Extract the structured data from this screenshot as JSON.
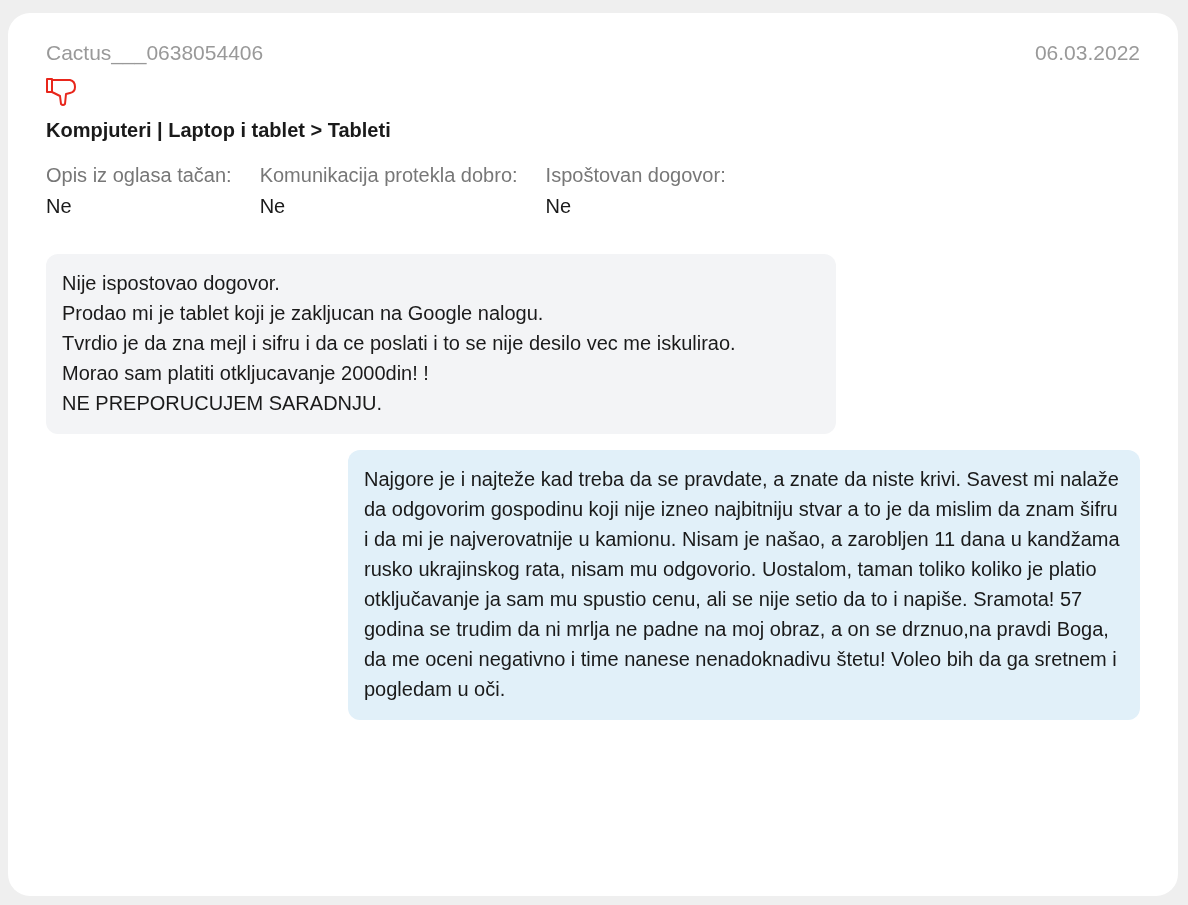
{
  "review": {
    "author": "Cactus___0638054406",
    "date": "06.03.2022",
    "negative": true,
    "category": "Kompjuteri | Laptop i tablet > Tableti",
    "criteria": [
      {
        "label": "Opis iz oglasa tačan:",
        "value": "Ne"
      },
      {
        "label": "Komunikacija protekla dobro:",
        "value": "Ne"
      },
      {
        "label": "Ispoštovan dogovor:",
        "value": "Ne"
      }
    ],
    "messages": [
      {
        "kind": "review",
        "lines": [
          "Nije ispostovao dogovor.",
          "Prodao mi je tablet koji je zakljucan na Google nalogu.",
          "Tvrdio je da zna mejl i sifru i da ce poslati i to se nije desilo vec me iskulirao.",
          "Morao sam platiti otkljucavanje 2000din! !",
          "NE PREPORUCUJEM SARADNJU."
        ]
      },
      {
        "kind": "reply",
        "lines": [
          "Najgore je i najteže kad treba da se pravdate, a znate da niste krivi. Savest mi nalaže da odgovorim gospodinu koji nije izneo najbitniju stvar a to je da mislim da znam šifru i da mi je najverovatnije u kamionu. Nisam je našao, a zarobljen 11 dana u kandžama rusko ukrajinskog rata, nisam mu odgovorio. Uostalom, taman toliko koliko je platio otključavanje ja sam mu spustio cenu, ali se nije setio da to i napiše. Sramota! 57 godina se trudim da ni mrlja ne padne na moj obraz, a on se drznuo,na pravdi Boga, da me oceni negativno i time nanese nenadoknadivu štetu! Voleo bih da ga sretnem i pogledam u oči."
        ]
      }
    ]
  }
}
